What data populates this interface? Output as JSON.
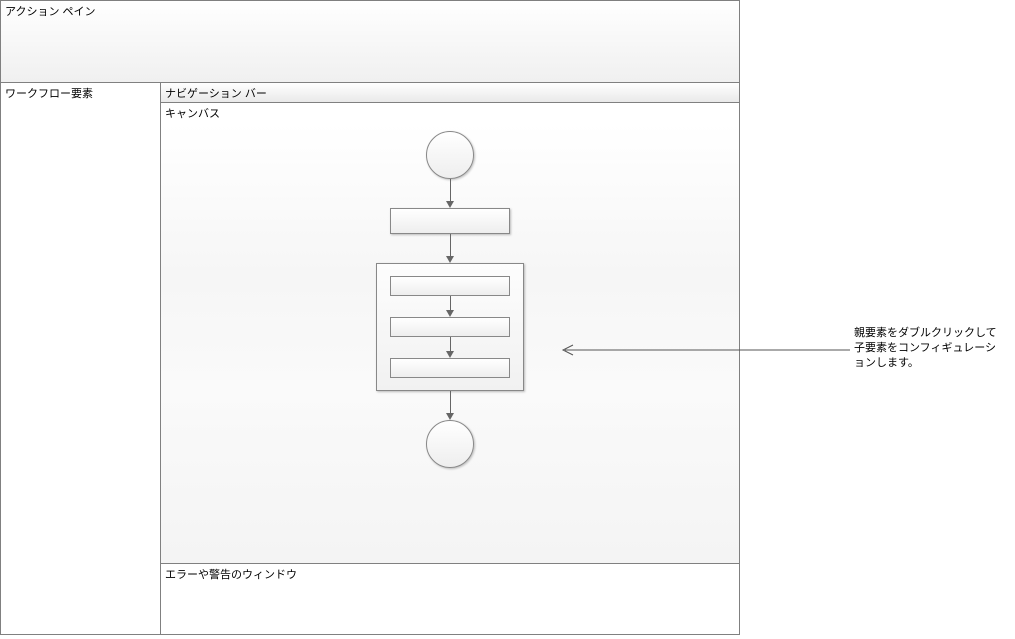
{
  "panes": {
    "actionPane": "アクション ペイン",
    "sidebar": "ワークフロー要素",
    "navBar": "ナビゲーション バー",
    "canvas": "キャンバス",
    "errors": "エラーや警告のウィンドウ"
  },
  "annotation": "親要素をダブルクリックして子要素をコンフィギュレーションします。"
}
